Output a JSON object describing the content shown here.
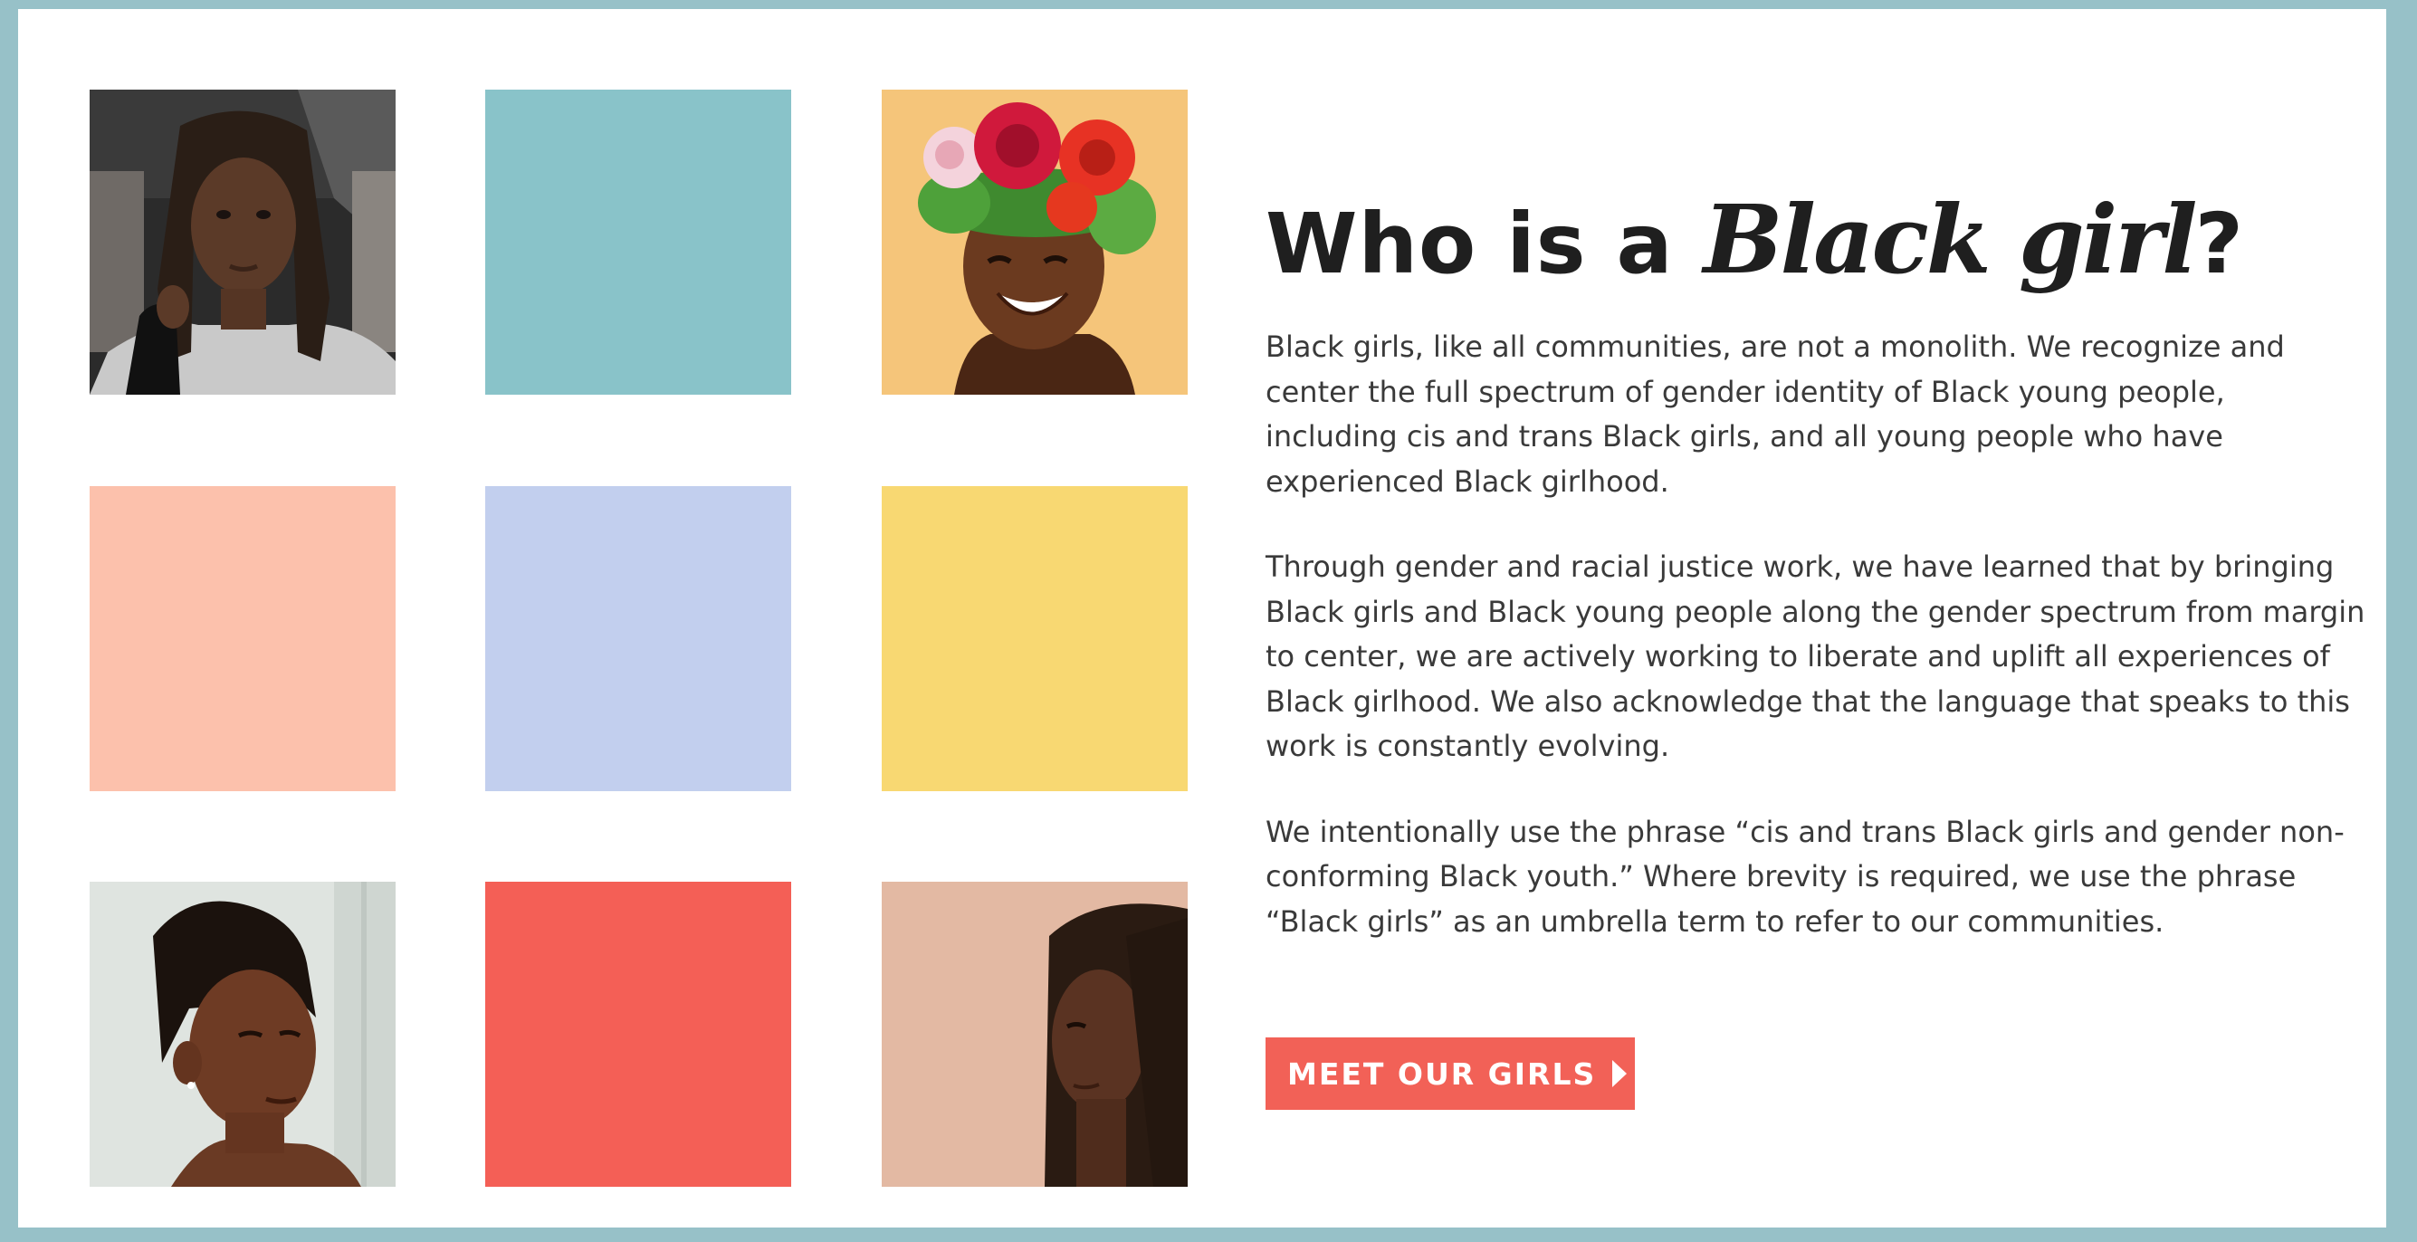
{
  "section": {
    "heading_prefix": "Who is a ",
    "heading_emphasis": "Black girl",
    "heading_suffix": "?",
    "paragraphs": [
      "Black girls, like all communities, are not a monolith. We recognize and center the full spectrum of gender identity of Black young people, including cis and trans Black girls, and all young people who have experienced Black girlhood.",
      "Through gender and racial justice work, we have learned that by bringing Black girls and Black young people along the gender spectrum from margin to center, we are actively working to liberate and uplift all experiences of Black girlhood. We also acknowledge that the language that speaks to this work is constantly evolving.",
      "We intentionally use the phrase “cis and trans Black girls and gender non-conforming Black youth.” Where brevity is required, we use the phrase “Black girls” as an umbrella term to refer to our communities."
    ],
    "cta_label": "MEET OUR GIRLS",
    "cta_icon": "play-arrow-icon"
  },
  "grid": {
    "tiles": [
      {
        "kind": "photo",
        "subject": "girl-with-braids-gray-hoodie"
      },
      {
        "kind": "color",
        "color": "#89c3c9"
      },
      {
        "kind": "photo",
        "subject": "smiling-girl-flower-crown"
      },
      {
        "kind": "color",
        "color": "#fcc1ac"
      },
      {
        "kind": "color",
        "color": "#c2cfee"
      },
      {
        "kind": "color",
        "color": "#f8d872"
      },
      {
        "kind": "photo",
        "subject": "girl-with-braided-updo"
      },
      {
        "kind": "color",
        "color": "#f45f56"
      },
      {
        "kind": "photo",
        "subject": "girl-with-braids-side-profile"
      }
    ]
  },
  "colors": {
    "frame_border": "#97c1c8",
    "cta_background": "#f26157",
    "heading_text": "#1f1f1f",
    "body_text": "#3a3a3a"
  }
}
